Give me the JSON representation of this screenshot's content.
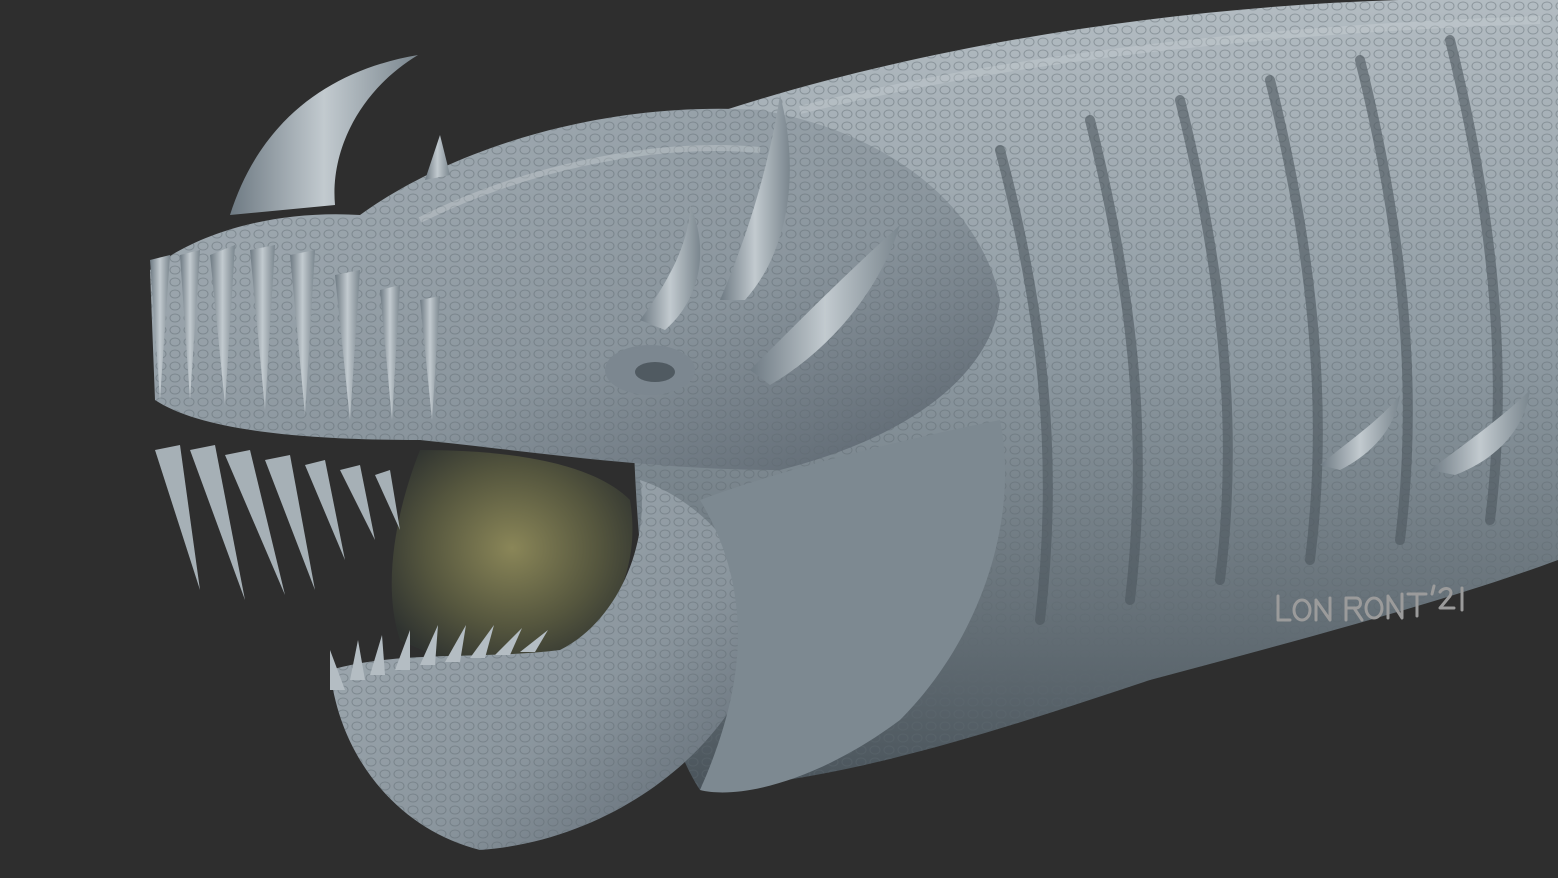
{
  "scene": {
    "subject": "sculpted-dragon-head",
    "background_color": "#2e2e2e",
    "material_color": "#8e9aa2",
    "highlight_color": "#c6ccd0",
    "shadow_color": "#3c4349",
    "mouth_interior_color": "#6b6a4a"
  },
  "signature": {
    "text": "LON RONT '21",
    "color": "#9b9b9b"
  }
}
